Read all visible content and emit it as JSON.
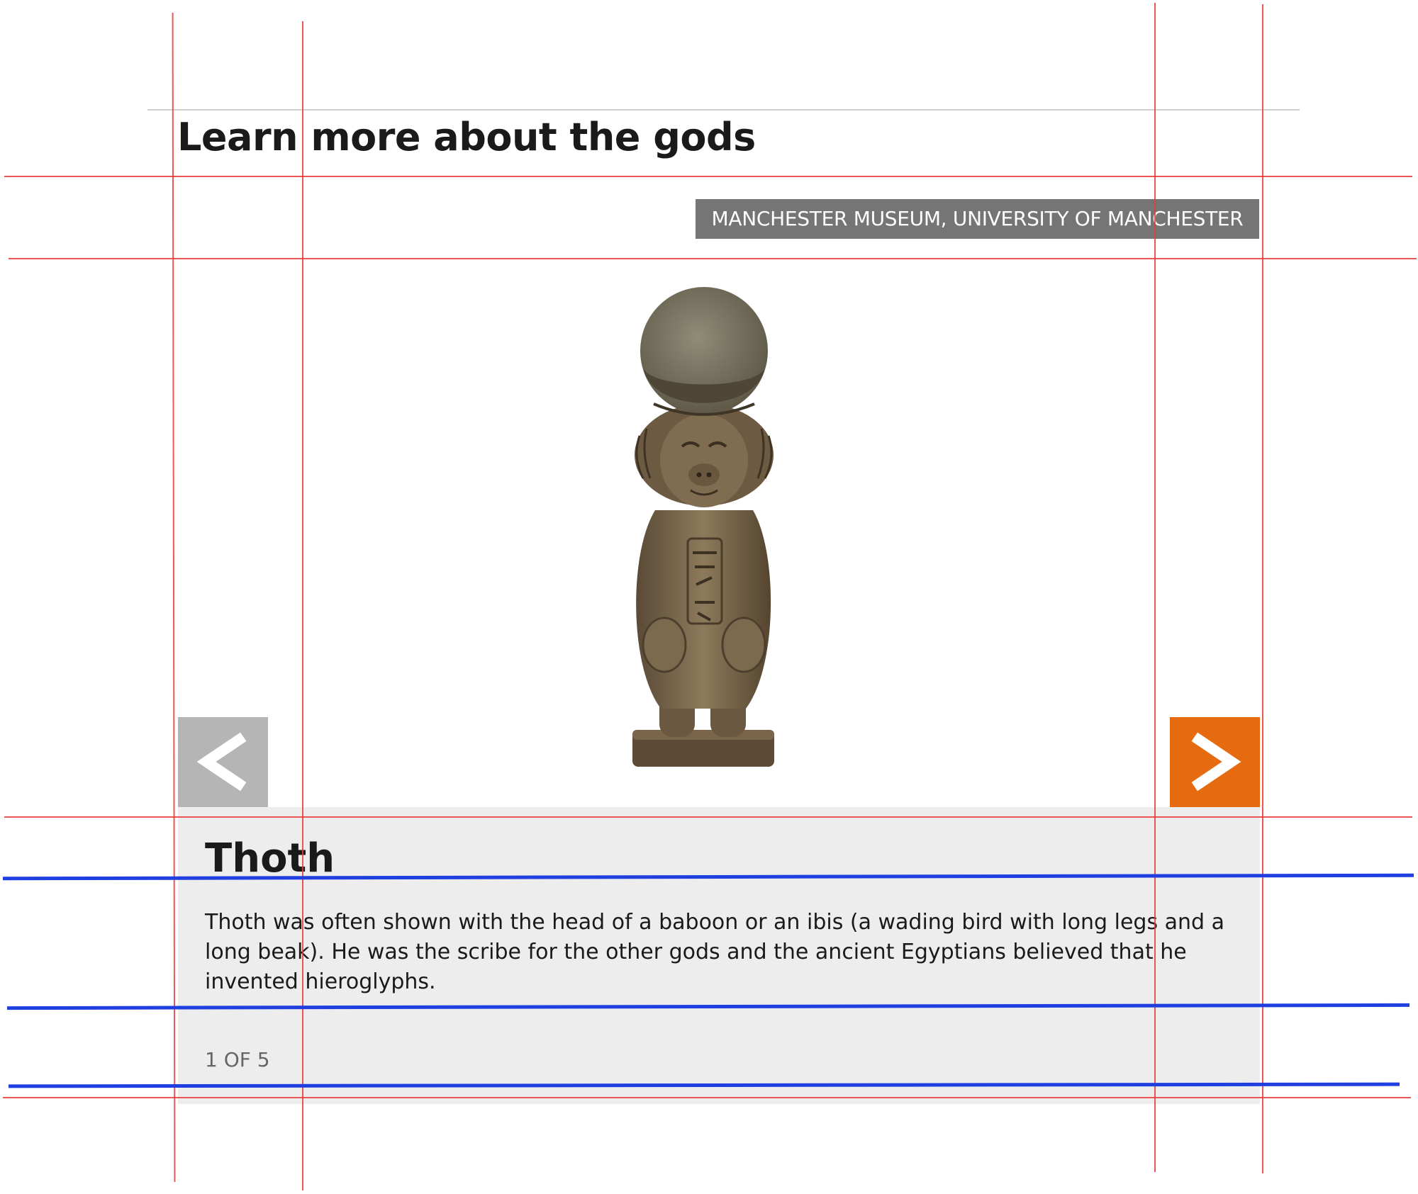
{
  "header": {
    "title": "Learn more about the gods"
  },
  "slide": {
    "credit": "MANCHESTER MUSEUM, UNIVERSITY OF MANCHESTER",
    "name": "Thoth",
    "description": "Thoth was often shown with the head of a baboon or an ibis (a wading bird with long legs and a long beak). He was the scribe for the other gods and the ancient Egyptians believed that he invented hieroglyphs.",
    "counter": "1 OF 5"
  },
  "controls": {
    "prev_icon": "chevron-left-icon",
    "next_icon": "chevron-right-icon"
  },
  "colors": {
    "credit_bg": "#757575",
    "prev_bg": "#b5b5b5",
    "next_bg": "#e66a0f",
    "panel_bg": "#ededed",
    "guide_red": "#e83838",
    "guide_blue": "#1f3fe0"
  }
}
